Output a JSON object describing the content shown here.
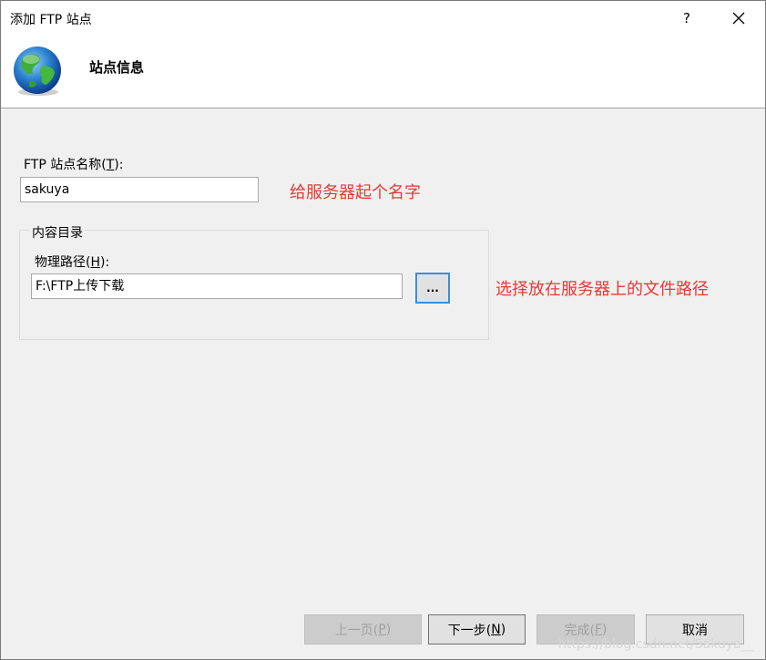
{
  "window": {
    "title": "添加 FTP 站点",
    "help_glyph": "?"
  },
  "header": {
    "title": "站点信息",
    "icon": "globe-icon"
  },
  "site_name": {
    "label_prefix": "FTP 站点名称(",
    "label_key": "T",
    "label_suffix": "):",
    "value": "sakuya"
  },
  "annotation_name": "给服务器起个名字",
  "content_dir": {
    "group_label": "内容目录",
    "path_label_prefix": "物理路径(",
    "path_label_key": "H",
    "path_label_suffix": "):",
    "path_value": "F:\\FTP上传下载",
    "browse_label": "..."
  },
  "annotation_path": "选择放在服务器上的文件路径",
  "footer": {
    "prev": {
      "prefix": "上一页(",
      "key": "P",
      "suffix": ")"
    },
    "next": {
      "prefix": "下一步(",
      "key": "N",
      "suffix": ")"
    },
    "finish": {
      "prefix": "完成(",
      "key": "F",
      "suffix": ")"
    },
    "cancel": "取消"
  },
  "watermark": "https://blog.csdn.net/Sakuya__"
}
